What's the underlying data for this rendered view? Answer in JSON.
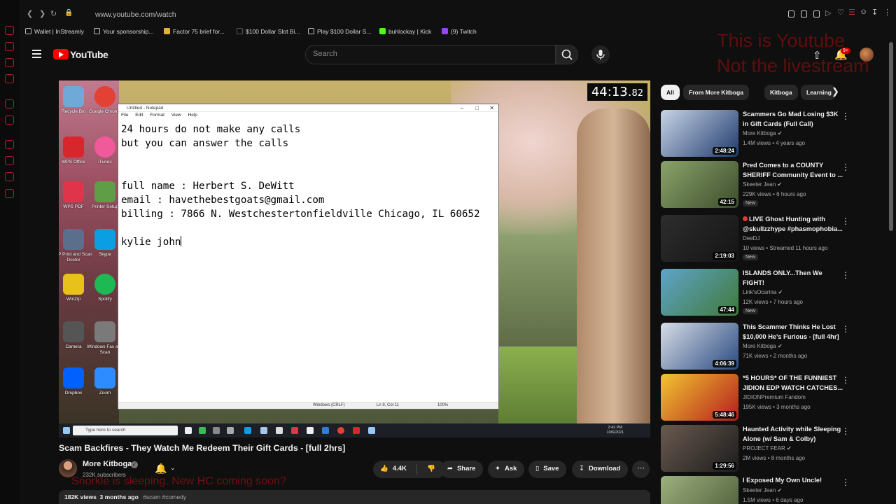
{
  "browser": {
    "url": "www.youtube.com/watch",
    "bookmarks": [
      {
        "label": "Wallet | InStreamly",
        "color": "#1e1e1e"
      },
      {
        "label": "Your sponsorship...",
        "color": "#1e1e1e"
      },
      {
        "label": "Factor 75 brief for...",
        "color": "#e2b33b"
      },
      {
        "label": "$100 Dollar Slot Bi...",
        "color": "#1e1e1e"
      },
      {
        "label": "Play $100 Dollar S...",
        "color": "#1e1e1e"
      },
      {
        "label": "buhlockay | Kick",
        "color": "#53fc18"
      },
      {
        "label": "(9) Twitch",
        "color": "#9146ff"
      }
    ]
  },
  "youtube": {
    "logo_text": "YouTube",
    "search_placeholder": "Search",
    "notification_count": "9+",
    "overlay_text": "This is Youtube\nNot the livestream"
  },
  "video": {
    "timer_main": "44:13.",
    "timer_fraction": "82",
    "notepad": {
      "window_title": "Untitled - Notepad",
      "menu": [
        "File",
        "Edit",
        "Format",
        "View",
        "Help"
      ],
      "lines": "24 hours do not make any calls\nbut you can answer the calls\n\n\nfull name : Herbert S. DeWitt\nemail : havethebestgoats@gmail.com\nbilling : 7866 N. Westchestertonfieldville Chicago, IL 60652\n\nkylie john",
      "status_encoding": "Windows (CRLF)",
      "status_position": "Ln 9, Col 11",
      "status_zoom": "100%"
    },
    "desktop_icons": [
      {
        "label": "Recycle Bin",
        "color": "#6ea9d8"
      },
      {
        "label": "Google Chrome",
        "color": "#e34133"
      },
      {
        "label": "WPS Office",
        "color": "#d7262c"
      },
      {
        "label": "iTunes",
        "color": "#f05a9a"
      },
      {
        "label": "WPS PDF",
        "color": "#e0344a"
      },
      {
        "label": "Printer Setup",
        "color": "#5f9e46"
      },
      {
        "label": "HP Print and Scan Doctor",
        "color": "#5a6f8c"
      },
      {
        "label": "Skype",
        "color": "#0b9ee3"
      },
      {
        "label": "WinZip",
        "color": "#e8c21b"
      },
      {
        "label": "Spotify",
        "color": "#1db954"
      },
      {
        "label": "Camera",
        "color": "#555555"
      },
      {
        "label": "Windows Fax and Scan",
        "color": "#7a7a7a"
      },
      {
        "label": "Dropbox",
        "color": "#0061fe"
      },
      {
        "label": "Zoom",
        "color": "#2d8cff"
      }
    ],
    "taskbar_search": "Type here to search",
    "taskbar_time": "2:42 PM",
    "taskbar_date": "10/6/2021"
  },
  "watch": {
    "title": "Scam Backfires - They Watch Me Redeem Their Gift Cards - [full 2hrs]",
    "channel": "More Kitboga",
    "subscribers": "232K subscribers",
    "overlay_text": "Snorkle is sleeping. New HC coming soon?",
    "likes": "4.4K",
    "share_label": "Share",
    "ask_label": "Ask",
    "save_label": "Save",
    "download_label": "Download",
    "description_stats": "182K views  3 months ago",
    "description_tags": "#scam #comedy"
  },
  "sidebar": {
    "chips": [
      "All",
      "From More Kitboga",
      "Kitboga",
      "Learning"
    ],
    "recommendations": [
      {
        "title": "Scammers Go Mad Losing $3K in Gift Cards (Full Call)",
        "channel": "More Kitboga",
        "verified": true,
        "meta": "1.4M views • 4 years ago",
        "duration": "2:48:24",
        "new": false,
        "live": false,
        "thumb_colors": [
          "#c7d4e6",
          "#1f3b6d"
        ]
      },
      {
        "title": "Pred Comes to a COUNTY SHERIFF Community Event to ...",
        "channel": "Skeeter Jean",
        "verified": true,
        "meta": "229K views • 6 hours ago",
        "duration": "42:15",
        "new": true,
        "live": false,
        "thumb_colors": [
          "#8aa36a",
          "#3d4d2c"
        ]
      },
      {
        "title": "LIVE Ghost Hunting with @skullzzhype #phasmophobia...",
        "channel": "DeeDJ",
        "verified": false,
        "meta": "10 views • Streamed 11 hours ago",
        "duration": "2:19:03",
        "new": true,
        "live": true,
        "thumb_colors": [
          "#2d2d2d",
          "#141414"
        ]
      },
      {
        "title": "ISLANDS ONLY...Then We FIGHT!",
        "channel": "Link'sOcarina",
        "verified": true,
        "meta": "12K views • 7 hours ago",
        "duration": "47:44",
        "new": true,
        "live": false,
        "thumb_colors": [
          "#5fa4c9",
          "#3f7a3a"
        ]
      },
      {
        "title": "This Scammer Thinks He Lost $10,000 He's Furious - [full 4hr]",
        "channel": "More Kitboga",
        "verified": true,
        "meta": "71K views • 2 months ago",
        "duration": "4:06:39",
        "new": false,
        "live": false,
        "thumb_colors": [
          "#d7dde6",
          "#2a4a82"
        ]
      },
      {
        "title": "*5 HOURS* OF THE FUNNIEST JIDION EDP WATCH CATCHES...",
        "channel": "JIDIONPremium Fandom",
        "verified": false,
        "meta": "195K views • 3 months ago",
        "duration": "5:48:46",
        "new": false,
        "live": false,
        "thumb_colors": [
          "#f2c531",
          "#b51d1d"
        ]
      },
      {
        "title": "Haunted Activity while Sleeping Alone (w/ Sam & Colby)",
        "channel": "PROJECT FEAR",
        "verified": true,
        "meta": "2M views • 8 months ago",
        "duration": "1:29:56",
        "new": false,
        "live": false,
        "thumb_colors": [
          "#6a5a4f",
          "#1c1c1c"
        ]
      },
      {
        "title": "I Exposed My Own Uncle!",
        "channel": "Skeeter Jean",
        "verified": true,
        "meta": "1.5M views • 6 days ago",
        "duration": "",
        "new": false,
        "live": false,
        "thumb_colors": [
          "#9db07e",
          "#4a5a36"
        ]
      }
    ]
  }
}
